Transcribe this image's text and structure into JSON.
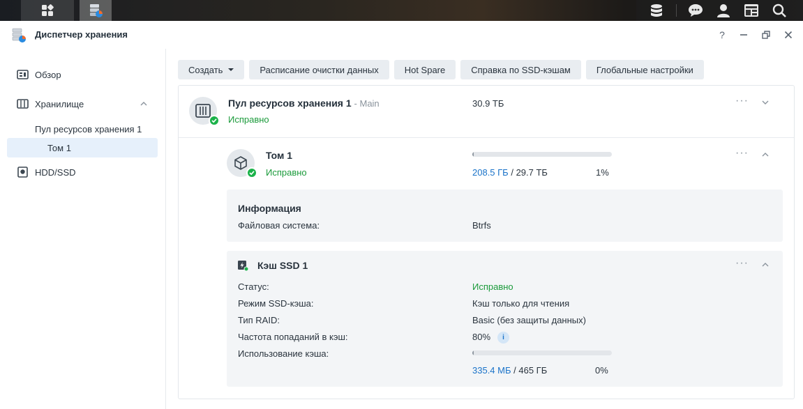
{
  "window": {
    "title": "Диспетчер хранения"
  },
  "sidebar": {
    "items": [
      {
        "label": "Обзор"
      },
      {
        "label": "Хранилище"
      },
      {
        "label": "Пул ресурсов хранения 1"
      },
      {
        "label": "Том 1"
      },
      {
        "label": "HDD/SSD"
      }
    ]
  },
  "toolbar": {
    "create": "Создать",
    "schedule": "Расписание очистки данных",
    "hot_spare": "Hot Spare",
    "ssd_help": "Справка по SSD-кэшам",
    "global": "Глобальные настройки"
  },
  "pool": {
    "name": "Пул ресурсов хранения 1",
    "suffix": "- Main",
    "status": "Исправно",
    "size": "30.9 ТБ"
  },
  "volume": {
    "name": "Том 1",
    "status": "Исправно",
    "used": "208.5 ГБ",
    "total": "/ 29.7 ТБ",
    "percent": "1%",
    "usage_fraction": 0.01
  },
  "info": {
    "heading": "Информация",
    "fs_label": "Файловая система:",
    "fs_value": "Btrfs"
  },
  "cache": {
    "name": "Кэш SSD 1",
    "status_label": "Статус:",
    "status_value": "Исправно",
    "mode_label": "Режим SSD-кэша:",
    "mode_value": "Кэш только для чтения",
    "raid_label": "Тип RAID:",
    "raid_value": "Basic (без защиты данных)",
    "hit_label": "Частота попаданий в кэш:",
    "hit_value": "80%",
    "usage_label": "Использование кэша:",
    "used": "335.4 МБ",
    "total": "/ 465 ГБ",
    "percent": "0%",
    "usage_fraction": 0.0
  },
  "colors": {
    "ok": "#1a9a3a",
    "link": "#1a73c9",
    "selected": "#e6f0fb"
  }
}
